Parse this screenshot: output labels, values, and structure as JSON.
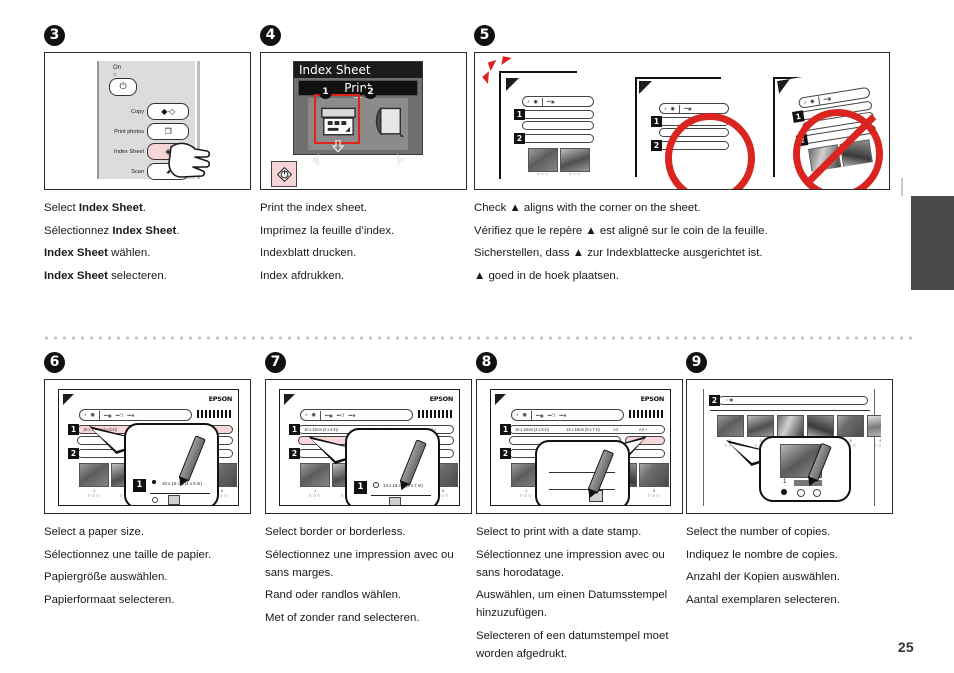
{
  "page": {
    "number": "25",
    "side_tab_color": "#4a4a4a",
    "accent_red": "#d9241f",
    "highlight_pink": "#f9d6da"
  },
  "steps": [
    {
      "id": "step-3",
      "number": "3",
      "figure_type": "printer-control-panel",
      "panel": {
        "power_label_line1": "On",
        "power_label_line2": "○",
        "power_icon": "⏻",
        "buttons": [
          {
            "label": "Copy",
            "icon": "copy-icon",
            "pressed": false
          },
          {
            "label": "Print photos",
            "icon": "photo-icon",
            "pressed": false
          },
          {
            "label": "Index Sheet",
            "icon": "index-sheet-icon",
            "pressed": true
          },
          {
            "label": "Scan",
            "icon": "scan-icon",
            "pressed": false
          }
        ]
      },
      "captions": [
        {
          "pre": "Select ",
          "bold": "Index Sheet",
          "post": "."
        },
        {
          "pre": "Sélectionnez ",
          "bold": "Index Sheet",
          "post": "."
        },
        {
          "pre": "",
          "bold": "Index Sheet",
          "post": " wählen."
        },
        {
          "pre": "",
          "bold": "Index Sheet",
          "post": " selecteren."
        }
      ]
    },
    {
      "id": "step-4",
      "number": "4",
      "figure_type": "lcd-screen",
      "lcd": {
        "title": "Index Sheet",
        "menu_value": "Print",
        "option_1_label": "1",
        "option_2_label": "2",
        "left_arrow": "◀",
        "right_arrow": "▶",
        "selected_option": "1"
      },
      "start_button_icon": "start-diamond-icon",
      "captions": [
        {
          "pre": "Print the index sheet.",
          "bold": "",
          "post": ""
        },
        {
          "pre": "Imprimez la feuille d’index.",
          "bold": "",
          "post": ""
        },
        {
          "pre": "Indexblatt drucken.",
          "bold": "",
          "post": ""
        },
        {
          "pre": "Index afdrukken.",
          "bold": "",
          "post": ""
        }
      ]
    },
    {
      "id": "step-5",
      "number": "5",
      "figure_type": "alignment-examples",
      "examples": [
        {
          "state": "correct",
          "mark": "alignment-corner-mark"
        },
        {
          "state": "prohibited-shifted",
          "mark": "no-circle"
        },
        {
          "state": "prohibited-rotated",
          "mark": "no-circle-slash"
        }
      ],
      "captions": [
        {
          "pre": "Check ▲ aligns with the corner on the sheet.",
          "bold": "",
          "post": ""
        },
        {
          "pre": "Vérifiez que le repère ▲ est aligné sur le coin de la feuille.",
          "bold": "",
          "post": ""
        },
        {
          "pre": "Sicherstellen, dass ▲ zur Indexblattecke ausgerichtet ist.",
          "bold": "",
          "post": ""
        },
        {
          "pre": "▲ goed in de hoek plaatsen.",
          "bold": "",
          "post": ""
        }
      ]
    },
    {
      "id": "step-6",
      "number": "6",
      "figure_type": "index-sheet-fill",
      "sheet": {
        "brand": "EPSON",
        "row_tags": [
          "1",
          "2"
        ],
        "highlight_row": 1,
        "callout_tag": "1",
        "callout_option_label": "10 x 15 cm (4 x 6 in)",
        "row1_options": [
          "10 x 15cm (4 x 6 in)",
          "13 x 18cm (5 x 7 in)",
          "A4",
          "A4 +"
        ]
      },
      "captions": [
        {
          "pre": "Select a paper size.",
          "bold": "",
          "post": ""
        },
        {
          "pre": "Sélectionnez une taille de papier.",
          "bold": "",
          "post": ""
        },
        {
          "pre": "Papiergröße auswählen.",
          "bold": "",
          "post": ""
        },
        {
          "pre": "Papierformaat selecteren.",
          "bold": "",
          "post": ""
        }
      ]
    },
    {
      "id": "step-7",
      "number": "7",
      "figure_type": "index-sheet-fill",
      "sheet": {
        "brand": "EPSON",
        "row_tags": [
          "1",
          "2"
        ],
        "highlight_row": 2,
        "callout_tag": "1",
        "callout_option_label": "13 x 18 cm (5 x 7 in)",
        "row1_options": [
          "10 x 15cm (4 x 6 in)",
          "13 x 18cm (5 x 7 in)",
          "A4",
          "A4 +"
        ]
      },
      "captions": [
        {
          "pre": "Select border or borderless.",
          "bold": "",
          "post": ""
        },
        {
          "pre": "Sélectionnez une impression avec ou sans marges.",
          "bold": "",
          "post": ""
        },
        {
          "pre": "Rand oder randlos wählen.",
          "bold": "",
          "post": ""
        },
        {
          "pre": "Met of zonder rand selecteren.",
          "bold": "",
          "post": ""
        }
      ]
    },
    {
      "id": "step-8",
      "number": "8",
      "figure_type": "index-sheet-fill",
      "sheet": {
        "brand": "EPSON",
        "row_tags": [
          "1",
          "2"
        ],
        "highlight_row": 2,
        "callout_tag": "",
        "callout_option_label": "",
        "row1_options": [
          "10 x 15cm (4 x 6 in)",
          "13 x 18cm (5 x 7 in)",
          "A4",
          "A4 +"
        ]
      },
      "captions": [
        {
          "pre": "Select to print with a date stamp.",
          "bold": "",
          "post": ""
        },
        {
          "pre": "Sélectionnez une impression avec ou sans horodatage.",
          "bold": "",
          "post": ""
        },
        {
          "pre": "Auswählen, um einen Datumsstempel hinzuzufügen.",
          "bold": "",
          "post": ""
        },
        {
          "pre": "Selecteren of een datumstempel moet worden afgedrukt.",
          "bold": "",
          "post": ""
        }
      ]
    },
    {
      "id": "step-9",
      "number": "9",
      "figure_type": "copies-selection",
      "sheet": {
        "row_tags": [
          "2"
        ],
        "callout_copy_number": "1"
      },
      "captions": [
        {
          "pre": "Select the number of copies.",
          "bold": "",
          "post": ""
        },
        {
          "pre": "Indiquez le nombre de copies.",
          "bold": "",
          "post": ""
        },
        {
          "pre": "Anzahl der Kopien auswählen.",
          "bold": "",
          "post": ""
        },
        {
          "pre": "Aantal exemplaren selecteren.",
          "bold": "",
          "post": ""
        }
      ]
    }
  ]
}
